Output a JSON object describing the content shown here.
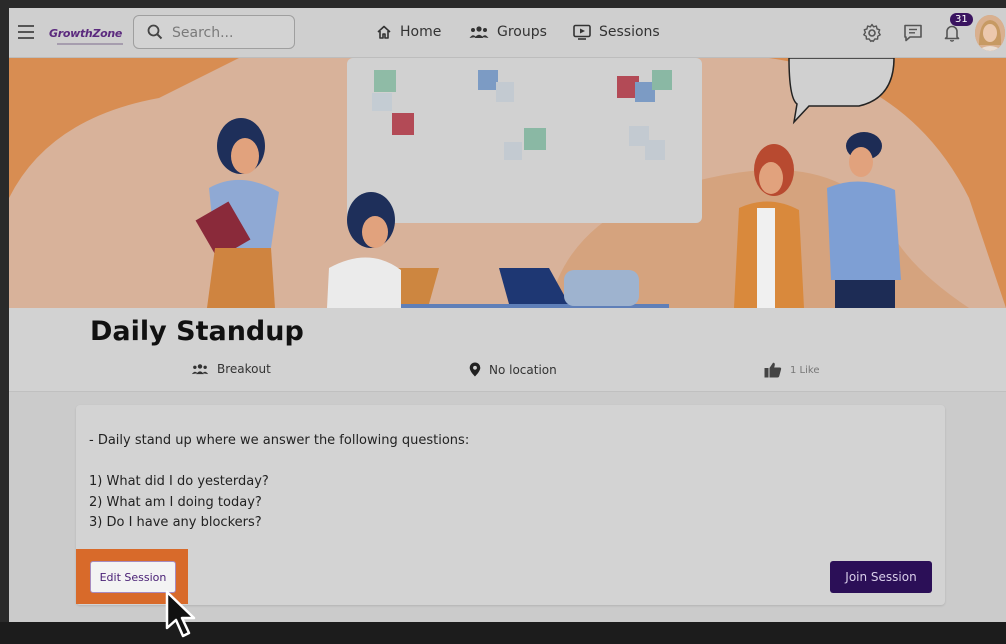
{
  "app": {
    "logo_text": "GrowthZone",
    "logo_brand_color": "#5b2a7e",
    "logo_accent_color": "#e2661d"
  },
  "search": {
    "placeholder": "Search..."
  },
  "nav": {
    "home": "Home",
    "groups": "Groups",
    "sessions": "Sessions"
  },
  "notifications": {
    "count": "31"
  },
  "session": {
    "title": "Daily Standup",
    "type": "Breakout",
    "location": "No location",
    "likes": "1 Like",
    "description": {
      "intro": "- Daily stand up where we answer the following questions:",
      "questions": [
        "1) What did I do yesterday?",
        "2) What am I doing today?",
        "3) Do I have any blockers?"
      ]
    }
  },
  "actions": {
    "edit_label": "Edit Session",
    "join_label": "Join Session",
    "highlight_color": "#d86a2a",
    "join_color": "#2b0f57"
  }
}
